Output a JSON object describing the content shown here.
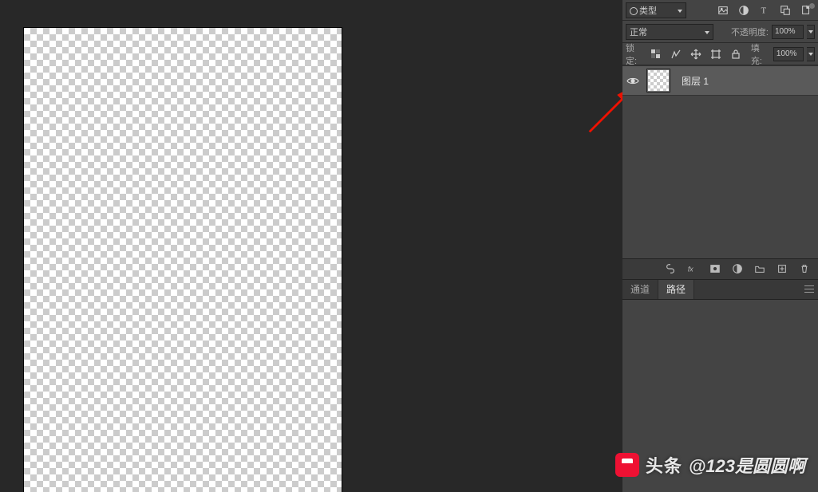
{
  "layers_panel": {
    "filter_type_label": "类型",
    "blend_mode": "正常",
    "opacity_label": "不透明度:",
    "opacity_value": "100%",
    "lock_label": "锁定:",
    "fill_label": "填充:",
    "fill_value": "100%",
    "entries": [
      {
        "name": "图层 1",
        "visible": true
      }
    ]
  },
  "secondary_tabs": {
    "tab_channels": "通道",
    "tab_paths": "路径",
    "active": "路径"
  },
  "watermark": {
    "source": "头条",
    "handle": "@123是圆圆啊"
  }
}
